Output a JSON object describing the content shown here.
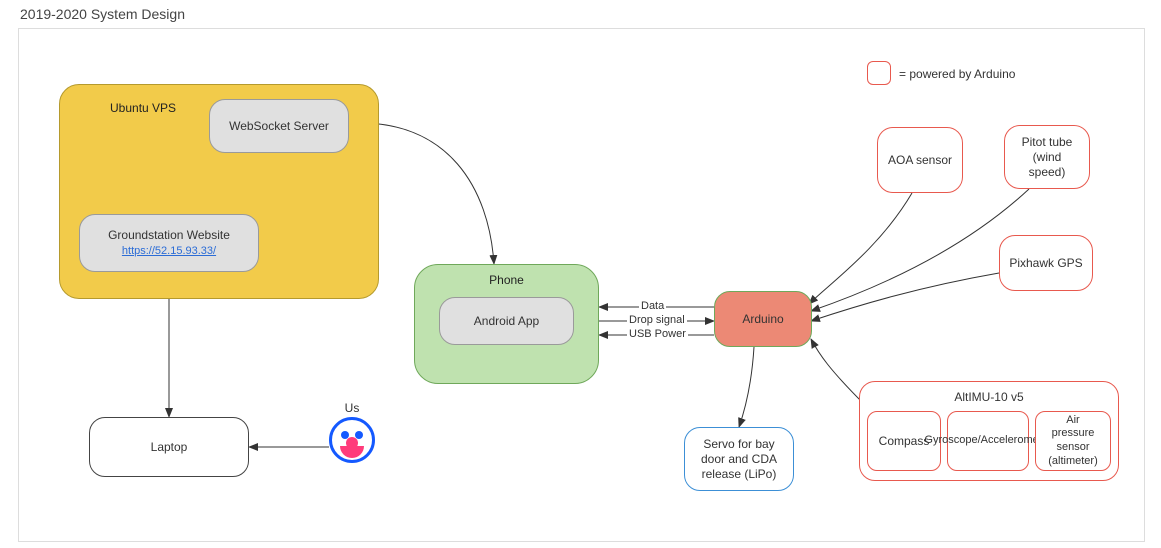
{
  "title": "2019-2020 System Design",
  "legend": {
    "swatch_color": "#e8594e",
    "text": "= powered by Arduino"
  },
  "nodes": {
    "ubuntu_vps": "Ubuntu VPS",
    "websocket_server": "WebSocket Server",
    "groundstation_website": "Groundstation Website",
    "groundstation_url": "https://52.15.93.33/",
    "phone": "Phone",
    "android_app": "Android App",
    "laptop": "Laptop",
    "us": "Us",
    "arduino": "Arduino",
    "servo": "Servo for bay door and CDA release (LiPo)",
    "aoa_sensor": "AOA sensor",
    "pitot_tube": "Pitot tube (wind speed)",
    "pixhawk_gps": "Pixhawk GPS",
    "altimu": {
      "title": "AltIMU-10 v5",
      "sub": {
        "compass": "Compass",
        "gyro": "Gyroscope/Accelerometer",
        "pressure": "Air pressure sensor (altimeter)"
      }
    }
  },
  "edges": {
    "data": "Data",
    "drop_signal": "Drop signal",
    "usb_power": "USB Power"
  }
}
